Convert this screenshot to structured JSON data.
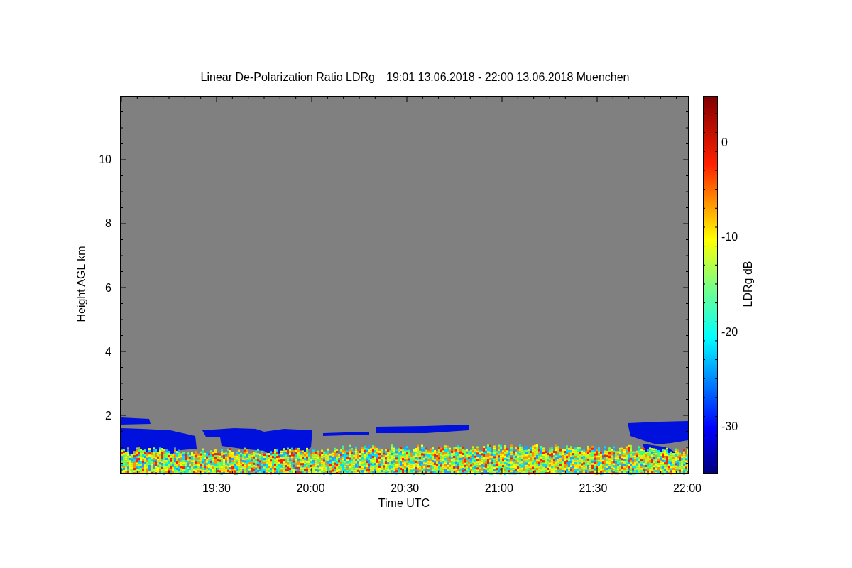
{
  "title": {
    "quantity": "Linear De-Polarization Ratio LDRg",
    "period": "19:01 13.06.2018 - 22:00 13.06.2018 Muenchen"
  },
  "y_axis": {
    "label": "Height AGL km",
    "ticks": [
      "10",
      "8",
      "6",
      "4",
      "2"
    ]
  },
  "x_axis": {
    "label": "Time UTC",
    "ticks": [
      "19:30",
      "20:00",
      "20:30",
      "21:00",
      "21:30",
      "22:00"
    ]
  },
  "colorbar": {
    "label": "LDRg dB",
    "ticks": [
      "0",
      "-10",
      "-20",
      "-30"
    ]
  }
}
